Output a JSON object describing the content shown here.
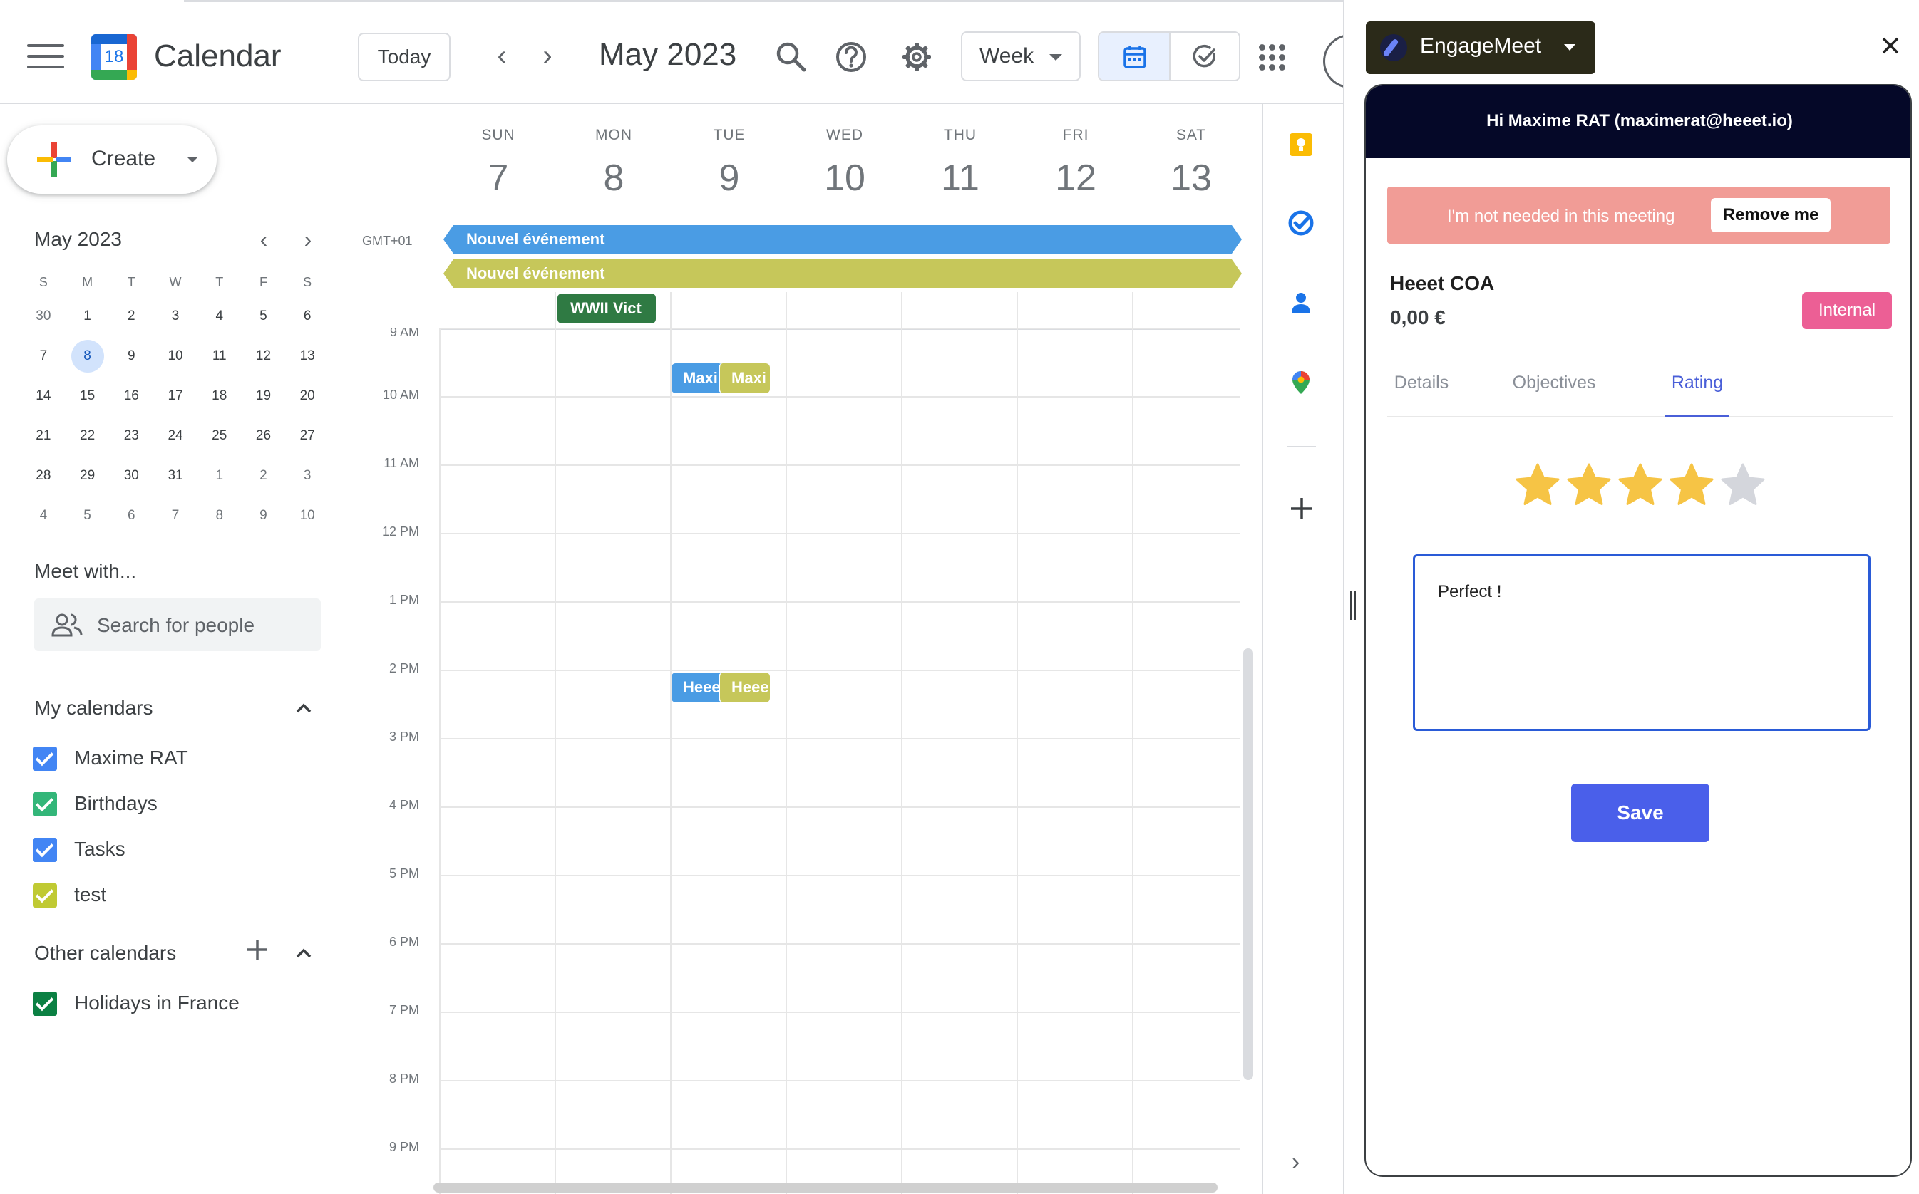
{
  "header": {
    "app_title": "Calendar",
    "logo_number": "18",
    "today_label": "Today",
    "month_title": "May 2023",
    "view_label": "Week"
  },
  "sidebar": {
    "create_label": "Create",
    "mini_cal": {
      "title": "May 2023",
      "dow": [
        "S",
        "M",
        "T",
        "W",
        "T",
        "F",
        "S"
      ],
      "weeks": [
        [
          "30",
          "1",
          "2",
          "3",
          "4",
          "5",
          "6"
        ],
        [
          "7",
          "8",
          "9",
          "10",
          "11",
          "12",
          "13"
        ],
        [
          "14",
          "15",
          "16",
          "17",
          "18",
          "19",
          "20"
        ],
        [
          "21",
          "22",
          "23",
          "24",
          "25",
          "26",
          "27"
        ],
        [
          "28",
          "29",
          "30",
          "31",
          "1",
          "2",
          "3"
        ],
        [
          "4",
          "5",
          "6",
          "7",
          "8",
          "9",
          "10"
        ]
      ]
    },
    "meet_with_title": "Meet with...",
    "search_placeholder": "Search for people",
    "my_calendars_title": "My calendars",
    "my_calendars": [
      {
        "name": "Maxime RAT",
        "color": "#4285f4"
      },
      {
        "name": "Birthdays",
        "color": "#33b679"
      },
      {
        "name": "Tasks",
        "color": "#4285f4"
      },
      {
        "name": "test",
        "color": "#c0ca33"
      }
    ],
    "other_calendars_title": "Other calendars",
    "other_calendars": [
      {
        "name": "Holidays in France",
        "color": "#0b8043"
      }
    ]
  },
  "week": {
    "timezone": "GMT+01",
    "days": [
      {
        "dow": "SUN",
        "num": "7"
      },
      {
        "dow": "MON",
        "num": "8"
      },
      {
        "dow": "TUE",
        "num": "9"
      },
      {
        "dow": "WED",
        "num": "10"
      },
      {
        "dow": "THU",
        "num": "11"
      },
      {
        "dow": "FRI",
        "num": "12"
      },
      {
        "dow": "SAT",
        "num": "13"
      }
    ],
    "hours": [
      "9 AM",
      "10 AM",
      "11 AM",
      "12 PM",
      "1 PM",
      "2 PM",
      "3 PM",
      "4 PM",
      "5 PM",
      "6 PM",
      "7 PM",
      "8 PM",
      "9 PM"
    ],
    "all_day_events": [
      {
        "title": "Nouvel événement",
        "color": "#4a9ce4"
      },
      {
        "title": "Nouvel événement",
        "color": "#c6c75a"
      },
      {
        "title": "WWII Vict",
        "color": "#2f7a43"
      }
    ],
    "events": [
      {
        "title": "Maxi",
        "color": "#4a9ce4"
      },
      {
        "title": "Maxi",
        "color": "#c6c75a"
      },
      {
        "title": "Heee",
        "color": "#4a9ce4"
      },
      {
        "title": "Heee",
        "color": "#c6c75a"
      }
    ]
  },
  "extension": {
    "brand": "EngageMeet",
    "greeting": "Hi Maxime RAT (maximerat@heeet.io)",
    "not_needed_text": "I'm not needed in this meeting",
    "remove_label": "Remove me",
    "meeting_title": "Heeet COA",
    "meeting_price": "0,00 €",
    "badge": "Internal",
    "tabs": [
      "Details",
      "Objectives",
      "Rating"
    ],
    "active_tab": "Rating",
    "rating": 4,
    "rating_max": 5,
    "comment": "Perfect !",
    "save_label": "Save"
  }
}
